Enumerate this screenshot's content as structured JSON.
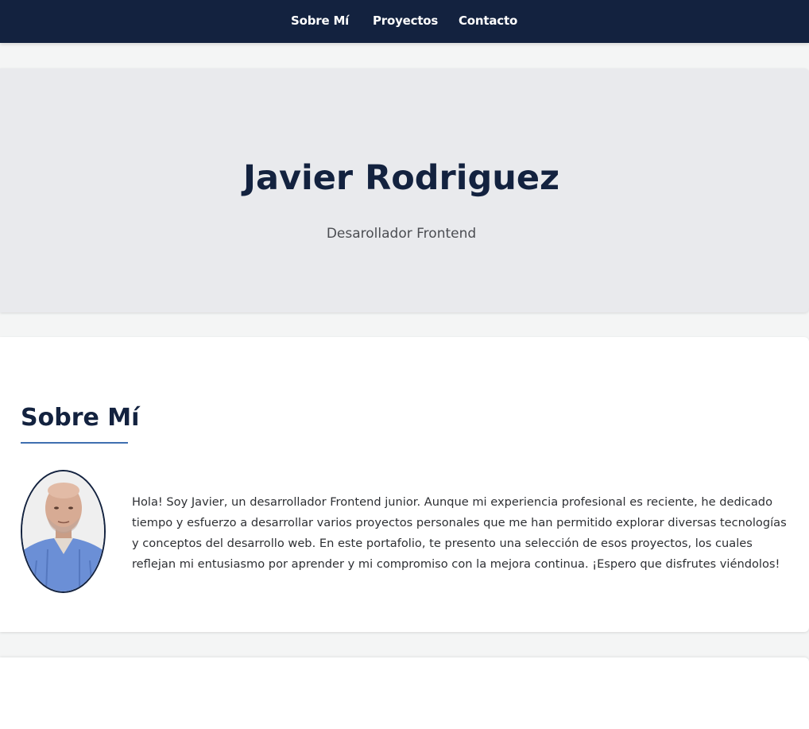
{
  "nav": {
    "items": [
      {
        "label": "Sobre Mí"
      },
      {
        "label": "Proyectos"
      },
      {
        "label": "Contacto"
      }
    ]
  },
  "hero": {
    "name": "Javier Rodriguez",
    "role": "Desarollador Frontend"
  },
  "about": {
    "title": "Sobre Mí",
    "text": "Hola! Soy Javier, un desarrollador Frontend junior. Aunque mi experiencia profesional es reciente, he dedicado tiempo y esfuerzo a desarrollar varios proyectos personales que me han permitido explorar diversas tecnologías y conceptos del desarrollo web. En este portafolio, te presento una selección de esos proyectos, los cuales reflejan mi entusiasmo por aprender y mi compromiso con la mejora continua. ¡Espero que disfrutes viéndolos!"
  },
  "colors": {
    "navbar": "#13223f",
    "accent": "#3f6fb0",
    "hero_bg": "#e9eaed",
    "page_bg": "#f4f5f5"
  }
}
